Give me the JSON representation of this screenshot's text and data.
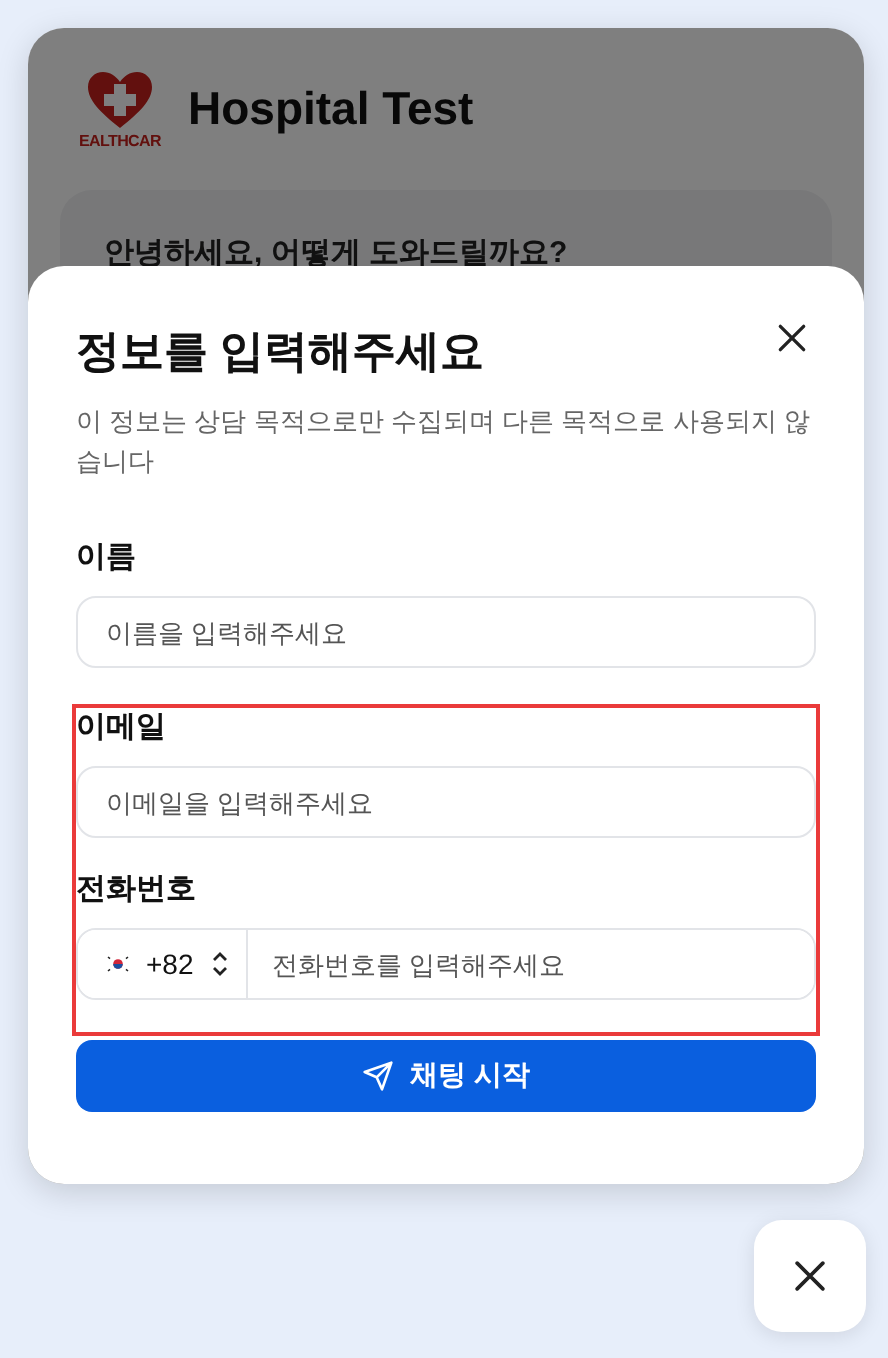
{
  "header": {
    "logo_text": "EALTHCAR",
    "title": "Hospital Test"
  },
  "greeting": "안녕하세요, 어떻게 도와드릴까요?",
  "overlay": {
    "dimmed": true
  },
  "modal": {
    "title": "정보를 입력해주세요",
    "subtitle": "이 정보는 상담 목적으로만 수집되며 다른 목적으로 사용되지 않습니다",
    "fields": [
      {
        "kind": "text",
        "label": "이름",
        "placeholder": "이름을 입력해주세요",
        "highlighted": false
      },
      {
        "kind": "text",
        "label": "이메일",
        "placeholder": "이메일을 입력해주세요",
        "highlighted": true
      },
      {
        "kind": "phone",
        "label": "전화번호",
        "country_code": "+82",
        "placeholder": "전화번호를 입력해주세요",
        "highlighted": true
      }
    ],
    "submit": "채팅 시작"
  }
}
